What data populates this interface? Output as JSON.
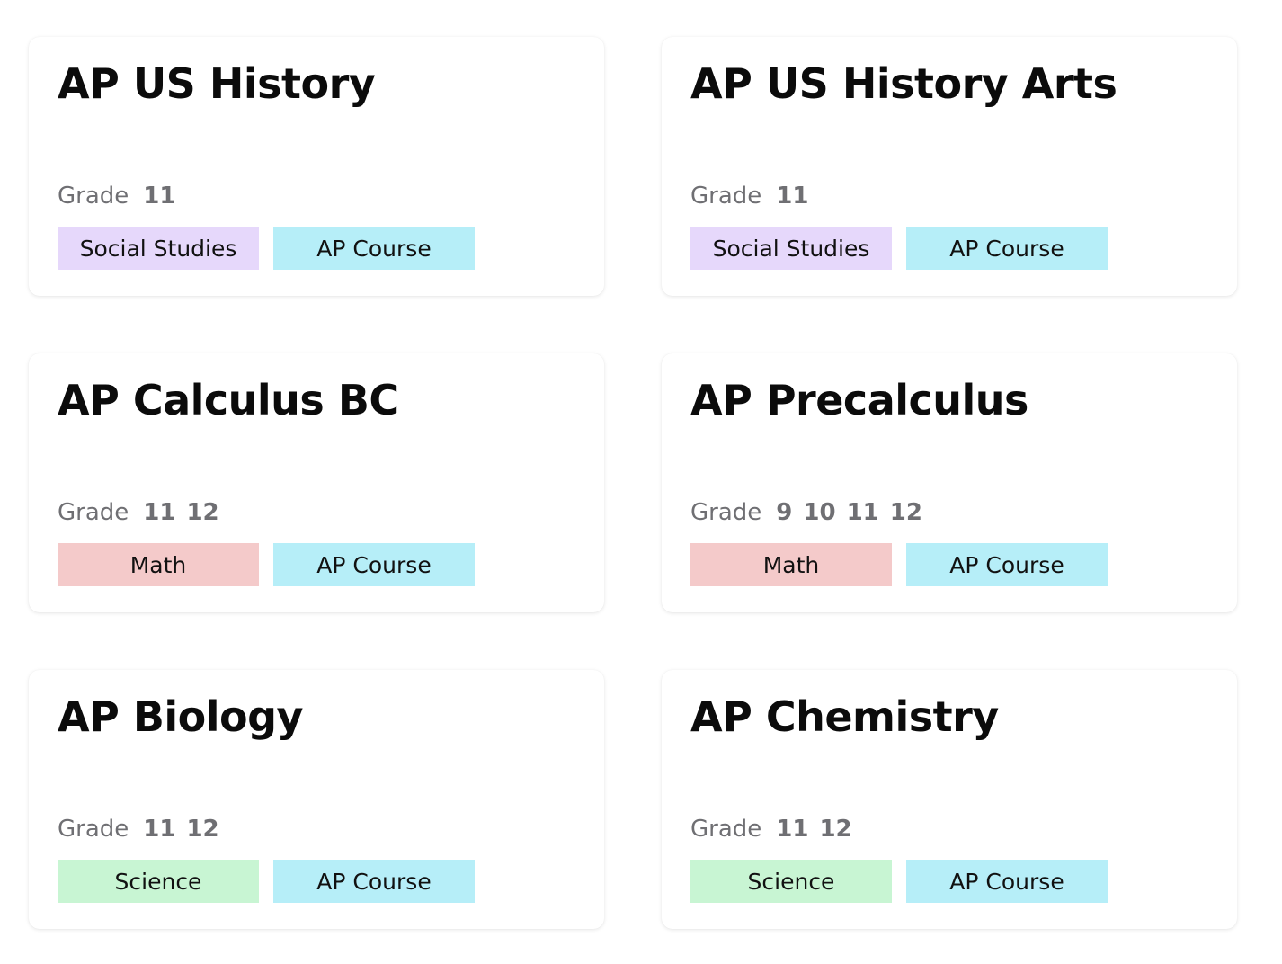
{
  "grade_label": "Grade",
  "tag_colors": {
    "Social Studies": "#e6d8fb",
    "Math": "#f4caca",
    "Science": "#c8f5d3",
    "AP Course": "#b6eef8"
  },
  "courses": [
    {
      "title": "AP US History",
      "grades": [
        "11"
      ],
      "tags": [
        "Social Studies",
        "AP Course"
      ]
    },
    {
      "title": "AP US History Arts",
      "grades": [
        "11"
      ],
      "tags": [
        "Social Studies",
        "AP Course"
      ]
    },
    {
      "title": "AP Calculus BC",
      "grades": [
        "11",
        "12"
      ],
      "tags": [
        "Math",
        "AP Course"
      ]
    },
    {
      "title": "AP Precalculus",
      "grades": [
        "9",
        "10",
        "11",
        "12"
      ],
      "tags": [
        "Math",
        "AP Course"
      ]
    },
    {
      "title": "AP Biology",
      "grades": [
        "11",
        "12"
      ],
      "tags": [
        "Science",
        "AP Course"
      ]
    },
    {
      "title": "AP Chemistry",
      "grades": [
        "11",
        "12"
      ],
      "tags": [
        "Science",
        "AP Course"
      ]
    }
  ]
}
